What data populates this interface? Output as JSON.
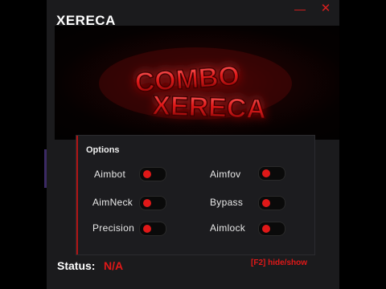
{
  "window": {
    "title": "XERECA",
    "minimize_symbol": "—",
    "close_symbol": "✕"
  },
  "banner": {
    "line1": "COMBO",
    "line2": "XERECA"
  },
  "options": {
    "heading": "Options",
    "items": [
      {
        "label": "Aimbot",
        "enabled": false
      },
      {
        "label": "Aimfov",
        "enabled": false
      },
      {
        "label": "AimNeck",
        "enabled": false
      },
      {
        "label": "Bypass",
        "enabled": false
      },
      {
        "label": "Precision",
        "enabled": false
      },
      {
        "label": "Aimlock",
        "enabled": false
      }
    ]
  },
  "status": {
    "label": "Status:",
    "value": "N/A"
  },
  "hotkey_hint": "[F2] hide/show",
  "colors": {
    "accent": "#e01818",
    "background": "#1b1b1d",
    "panel": "#1c1c1f"
  }
}
